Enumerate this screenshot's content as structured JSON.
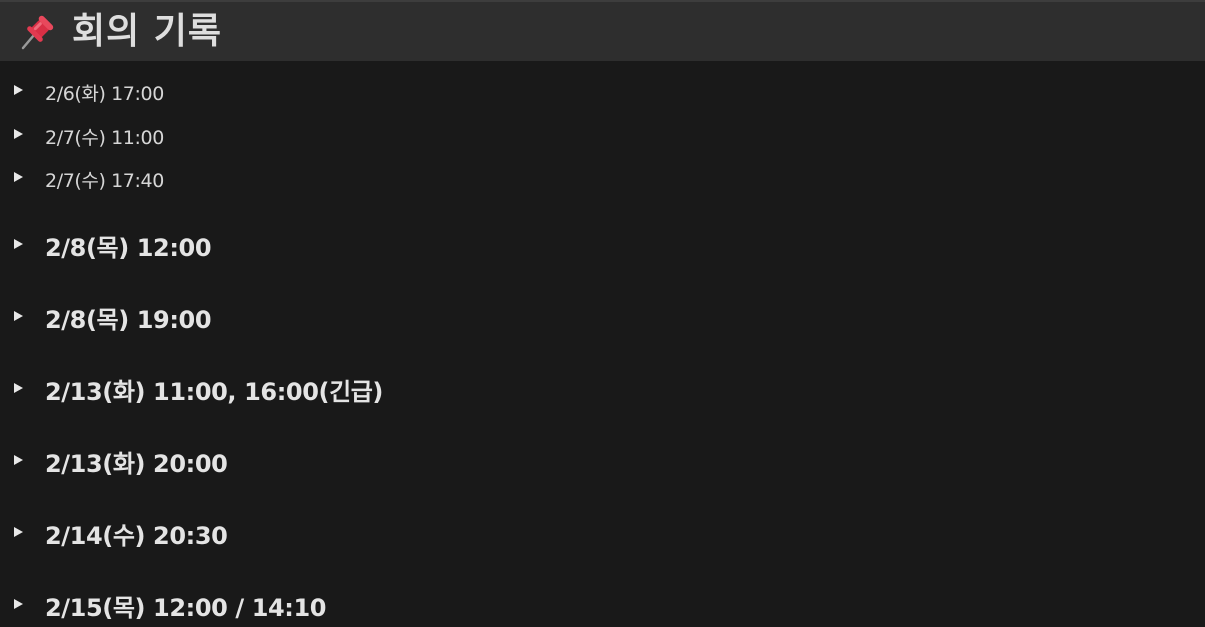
{
  "page": {
    "icon": "pushpin-icon",
    "title": "회의 기록"
  },
  "colors": {
    "background": "#191919",
    "header_background": "#2e2e2e",
    "text": "#e4e4e4"
  },
  "meetings": [
    {
      "label": "2/6(화) 17:00"
    },
    {
      "label": "2/7(수) 11:00"
    },
    {
      "label": "2/7(수) 17:40"
    },
    {
      "label": "2/8(목) 12:00"
    },
    {
      "label": "2/8(목) 19:00"
    },
    {
      "label": "2/13(화) 11:00, 16:00(긴급)"
    },
    {
      "label": "2/13(화) 20:00"
    },
    {
      "label": "2/14(수) 20:30"
    },
    {
      "label": "2/15(목) 12:00 / 14:10"
    }
  ]
}
